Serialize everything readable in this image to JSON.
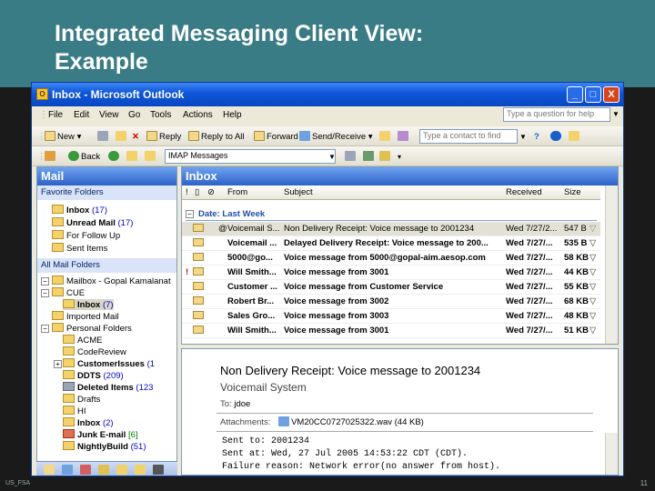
{
  "slide": {
    "title_line1": "Integrated Messaging Client View:",
    "title_line2": "Example",
    "footer_left": "US_FSA",
    "page_number": "11"
  },
  "window": {
    "title": "Inbox - Microsoft Outlook",
    "minimize": "_",
    "maximize": "□",
    "close": "X"
  },
  "menu": {
    "items": [
      "File",
      "Edit",
      "View",
      "Go",
      "Tools",
      "Actions",
      "Help"
    ],
    "help_placeholder": "Type a question for help"
  },
  "toolbar1": {
    "new": "New",
    "reply": "Reply",
    "reply_all": "Reply to All",
    "forward": "Forward",
    "send_receive": "Send/Receive",
    "find_placeholder": "Type a contact to find"
  },
  "toolbar2": {
    "back": "Back",
    "imap": "IMAP Messages"
  },
  "nav": {
    "title": "Mail",
    "favorites_header": "Favorite Folders",
    "favorites": [
      {
        "name": "Inbox",
        "count": "(17)"
      },
      {
        "name": "Unread Mail",
        "count": "(17)"
      },
      {
        "name": "For Follow Up",
        "count": ""
      },
      {
        "name": "Sent Items",
        "count": ""
      }
    ],
    "all_header": "All Mail Folders",
    "folders": [
      {
        "name": "Mailbox - Gopal Kamalanat",
        "count": ""
      },
      {
        "name": "CUE",
        "count": ""
      },
      {
        "name": "Inbox",
        "count": "(7)"
      },
      {
        "name": "Imported Mail",
        "count": ""
      },
      {
        "name": "Personal Folders",
        "count": ""
      },
      {
        "name": "ACME",
        "count": ""
      },
      {
        "name": "CodeReview",
        "count": ""
      },
      {
        "name": "CustomerIssues",
        "count": "(1"
      },
      {
        "name": "DDTS",
        "count": "(209)"
      },
      {
        "name": "Deleted Items",
        "count": "(123"
      },
      {
        "name": "Drafts",
        "count": ""
      },
      {
        "name": "HI",
        "count": ""
      },
      {
        "name": "Inbox",
        "count": "(2)"
      },
      {
        "name": "Junk E-mail",
        "count": "[6]"
      },
      {
        "name": "NightlyBuild",
        "count": "(51)"
      }
    ]
  },
  "inbox": {
    "title": "Inbox",
    "columns": {
      "from": "From",
      "subject": "Subject",
      "received": "Received",
      "size": "Size"
    },
    "group": "Date: Last Week",
    "rows": [
      {
        "from": "Voicemail S...",
        "subject": "Non Delivery Receipt: Voice message to 2001234",
        "received": "Wed 7/27/2...",
        "size": "547 B"
      },
      {
        "from": "Voicemail ...",
        "subject": "Delayed Delivery Receipt: Voice message to 200...",
        "received": "Wed 7/27/...",
        "size": "535 B"
      },
      {
        "from": "5000@go...",
        "subject": "Voice message from 5000@gopal-aim.aesop.com",
        "received": "Wed 7/27/...",
        "size": "58 KB"
      },
      {
        "from": "Will Smith...",
        "subject": "Voice message from 3001",
        "received": "Wed 7/27/...",
        "size": "44 KB"
      },
      {
        "from": "Customer ...",
        "subject": "Voice message from Customer Service",
        "received": "Wed 7/27/...",
        "size": "55 KB"
      },
      {
        "from": "Robert Br...",
        "subject": "Voice message from 3002",
        "received": "Wed 7/27/...",
        "size": "68 KB"
      },
      {
        "from": "Sales Gro...",
        "subject": "Voice message from 3003",
        "received": "Wed 7/27/...",
        "size": "48 KB"
      },
      {
        "from": "Will Smith...",
        "subject": "Voice message from 3001",
        "received": "Wed 7/27/...",
        "size": "51 KB"
      }
    ]
  },
  "preview": {
    "subject": "Non Delivery Receipt: Voice message to 2001234",
    "from": "Voicemail System",
    "to_label": "To:",
    "to": "jdoe",
    "attachments_label": "Attachments:",
    "attachment": "VM20CC0727025322.wav (44 KB)",
    "body_line1": "Sent to: 2001234",
    "body_line2": "Sent at: Wed, 27 Jul 2005 14:53:22 CDT (CDT).",
    "body_line3": "Failure reason: Network error(no answer from host)."
  }
}
